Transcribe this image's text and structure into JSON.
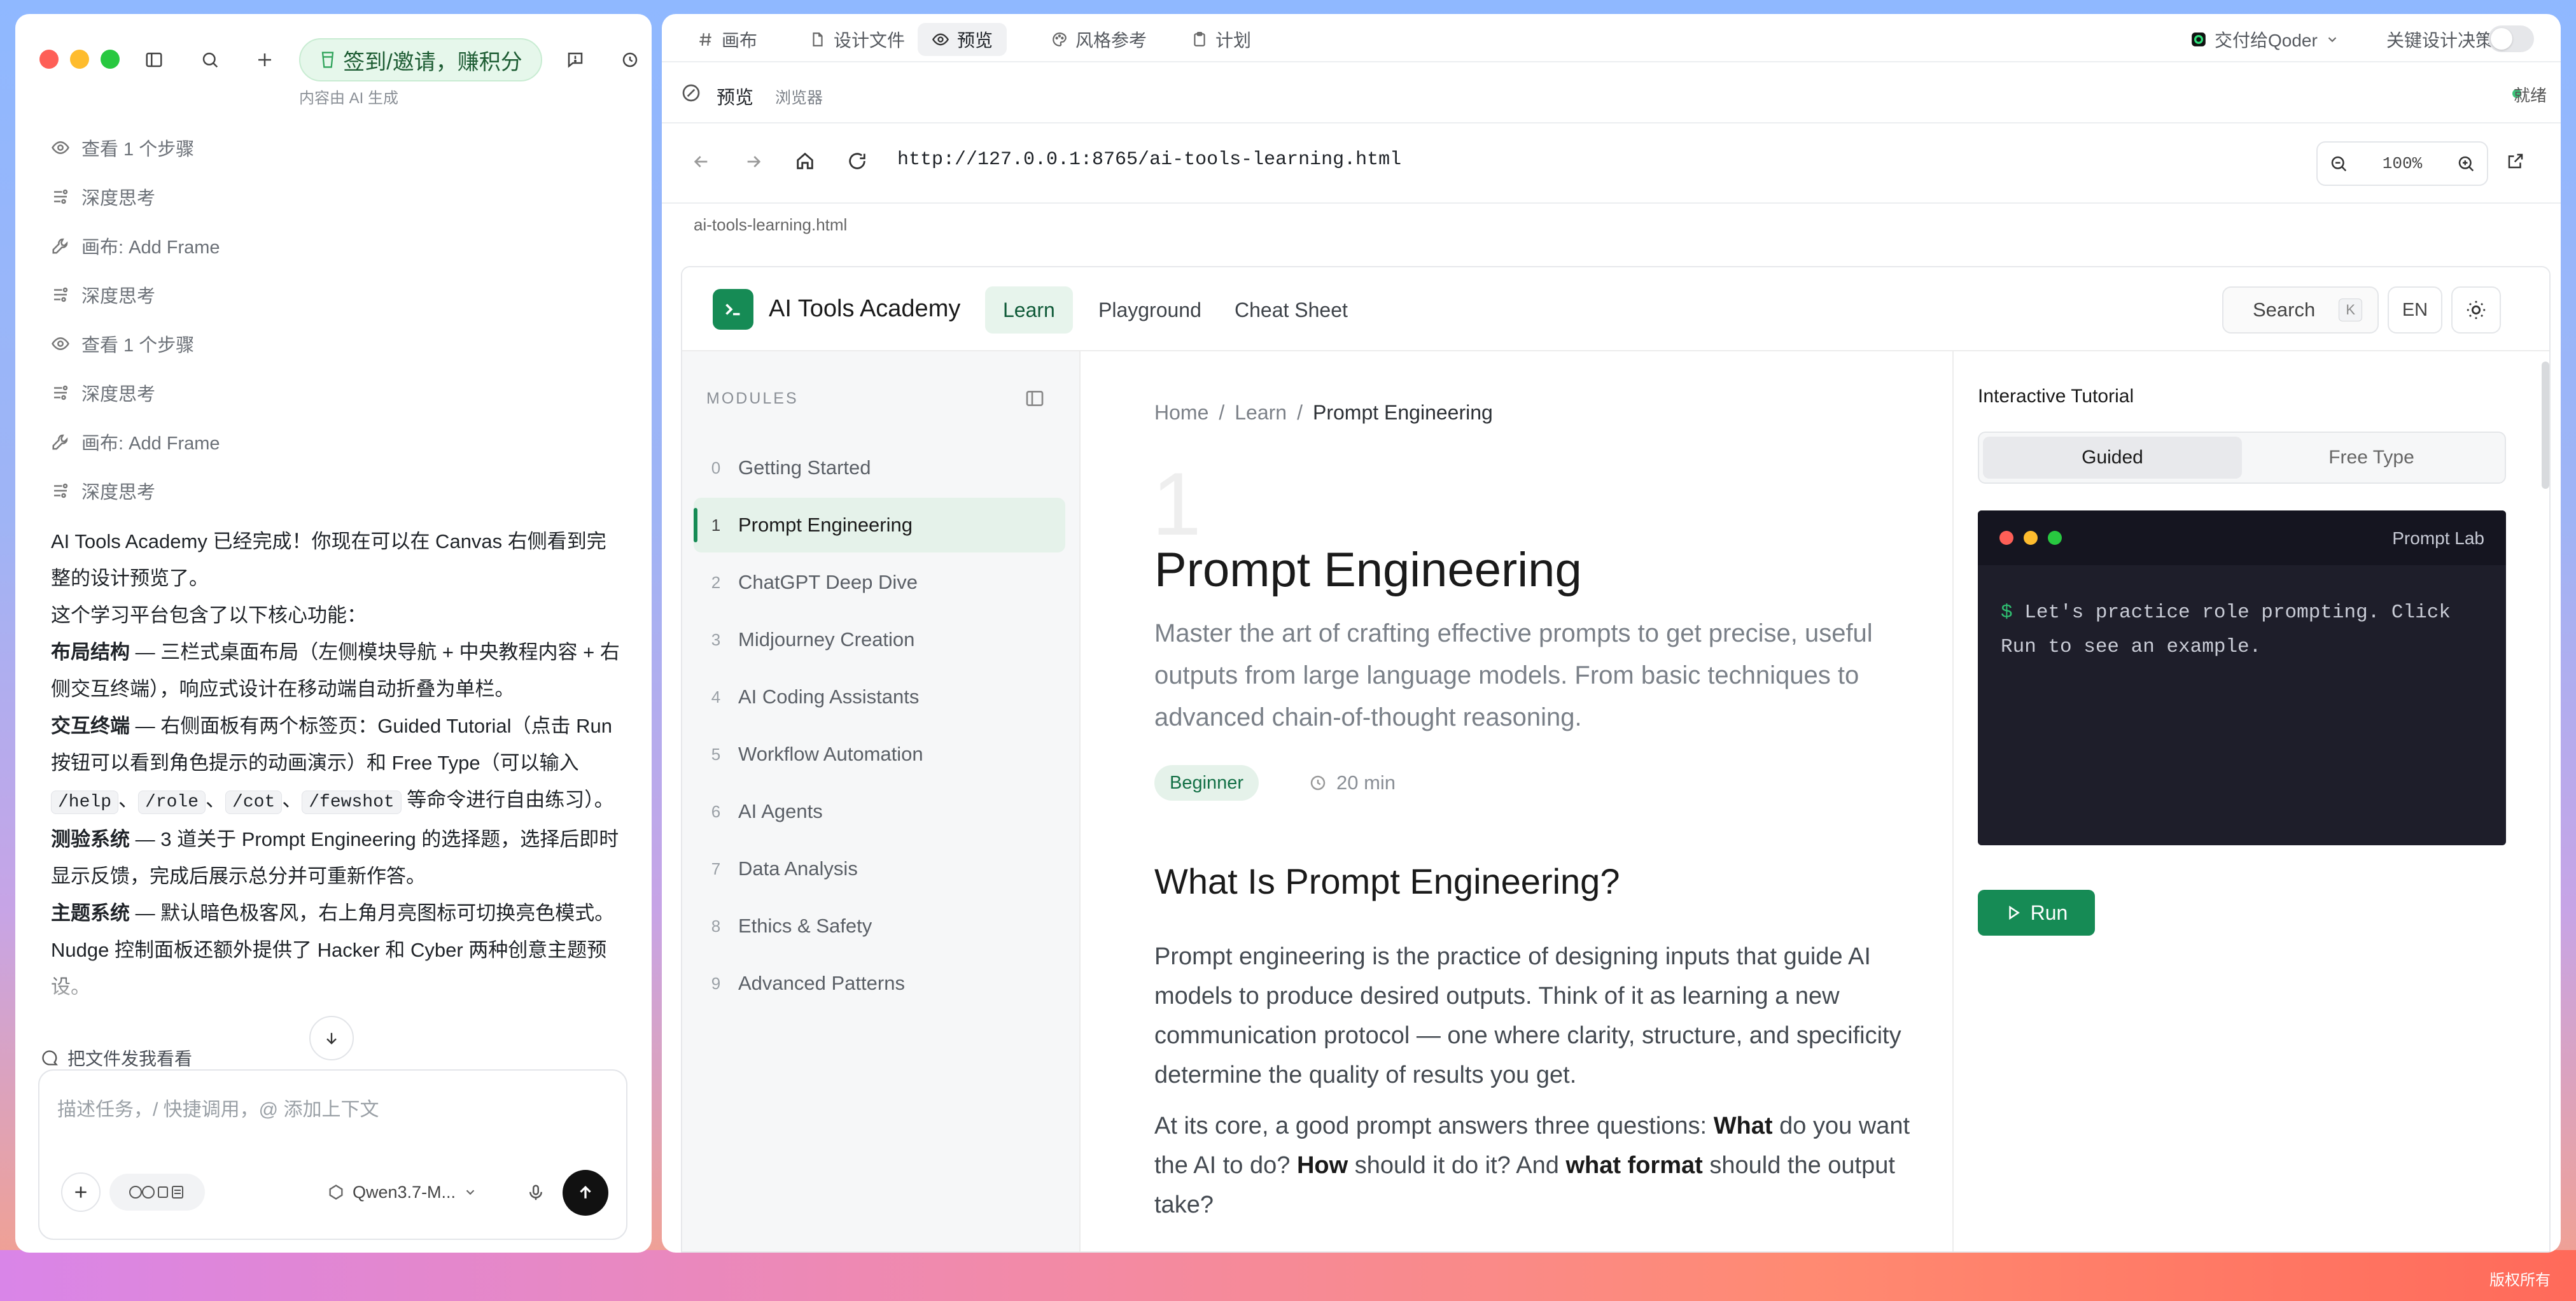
{
  "colors": {
    "accent": "#168b55",
    "accent_soft": "#e5f2ea",
    "terminal_bg": "#1e1e2a"
  },
  "left": {
    "promo_label": "签到/邀请，赚积分",
    "promo_sub": "内容由 AI 生成",
    "steps": [
      {
        "icon": "eye-icon",
        "label": "查看 1 个步骤"
      },
      {
        "icon": "brain-icon",
        "label": "深度思考"
      },
      {
        "icon": "wrench-icon",
        "label": "画布: Add Frame"
      },
      {
        "icon": "brain-icon",
        "label": "深度思考"
      },
      {
        "icon": "eye-icon",
        "label": "查看 1 个步骤"
      },
      {
        "icon": "brain-icon",
        "label": "深度思考"
      },
      {
        "icon": "wrench-icon",
        "label": "画布: Add Frame"
      },
      {
        "icon": "brain-icon",
        "label": "深度思考"
      }
    ],
    "message": {
      "intro1": "AI Tools Academy 已经完成！你现在可以在 Canvas 右侧看到完整的设计预览了。",
      "intro2": "这个学习平台包含了以下核心功能：",
      "f1_title": "布局结构",
      "f1_text": " — 三栏式桌面布局（左侧模块导航 + 中央教程内容 + 右侧交互终端），响应式设计在移动端自动折叠为单栏。",
      "f2_title": "交互终端",
      "f2_text": " — 右侧面板有两个标签页：Guided Tutorial（点击 Run 按钮可以看到角色提示的动画演示）和 Free Type（可以输入 ",
      "cmd1": "/help",
      "sep": "、",
      "cmd2": "/role",
      "cmd3": "/cot",
      "cmd4": "/fewshot",
      "f2_tail": " 等命令进行自由练习）。",
      "f3_title": "测验系统",
      "f3_text": " — 3 道关于 Prompt Engineering 的选择题，选择后即时显示反馈，完成后展示总分并可重新作答。",
      "f4_title": "主题系统",
      "f4_text": " — 默认暗色极客风，右上角月亮图标可切换亮色模式。Nudge 控制面板还额外提供了 Hacker 和 Cyber 两种创意主题预设。"
    },
    "attach_label": "把文件发我看看",
    "composer_placeholder": "描述任务，/ 快捷调用，@ 添加上下文",
    "model": "Qwen3.7-M..."
  },
  "right": {
    "tabs": [
      "画布",
      "设计文件",
      "预览",
      "风格参考",
      "计划"
    ],
    "active_tab": 2,
    "handoff": "交付给Qoder",
    "key_decisions": "关键设计决策",
    "bar_title": "预览",
    "bar_browser": "浏览器",
    "status": "就绪",
    "url": "http://127.0.0.1:8765/ai-tools-learning.html",
    "zoom": "100%",
    "filename": "ai-tools-learning.html"
  },
  "site": {
    "brand": "AI Tools Academy",
    "nav": [
      "Learn",
      "Playground",
      "Cheat Sheet"
    ],
    "search": "Search",
    "search_key": "K",
    "lang": "EN",
    "modules_label": "MODULES",
    "modules": [
      {
        "n": "0",
        "label": "Getting Started"
      },
      {
        "n": "1",
        "label": "Prompt Engineering"
      },
      {
        "n": "2",
        "label": "ChatGPT Deep Dive"
      },
      {
        "n": "3",
        "label": "Midjourney Creation"
      },
      {
        "n": "4",
        "label": "AI Coding Assistants"
      },
      {
        "n": "5",
        "label": "Workflow Automation"
      },
      {
        "n": "6",
        "label": "AI Agents"
      },
      {
        "n": "7",
        "label": "Data Analysis"
      },
      {
        "n": "8",
        "label": "Ethics & Safety"
      },
      {
        "n": "9",
        "label": "Advanced Patterns"
      }
    ],
    "active_module": 1,
    "crumbs": [
      "Home",
      "Learn",
      "Prompt Engineering"
    ],
    "crumb_sep": "/",
    "big_number": "1",
    "title": "Prompt Engineering",
    "lead": "Master the art of crafting effective prompts to get precise, useful outputs from large language models. From basic techniques to advanced chain-of-thought reasoning.",
    "level": "Beginner",
    "duration": "20 min",
    "h2": "What Is Prompt Engineering?",
    "p1": "Prompt engineering is the practice of designing inputs that guide AI models to produce desired outputs. Think of it as learning a new communication protocol — one where clarity, structure, and specificity determine the quality of results you get.",
    "p2_a": "At its core, a good prompt answers three questions: ",
    "p2_b1": "What",
    "p2_c": " do you want the AI to do? ",
    "p2_b2": "How",
    "p2_d": " should it do it? And ",
    "p2_b3": "what format",
    "p2_e": " should the output take?",
    "panel_title": "Interactive Tutorial",
    "seg": [
      "Guided",
      "Free Type"
    ],
    "terminal_title": "Prompt Lab",
    "terminal_prompt": "$",
    "terminal_text": "Let's practice role prompting. Click Run to see an example.",
    "run": "Run"
  }
}
